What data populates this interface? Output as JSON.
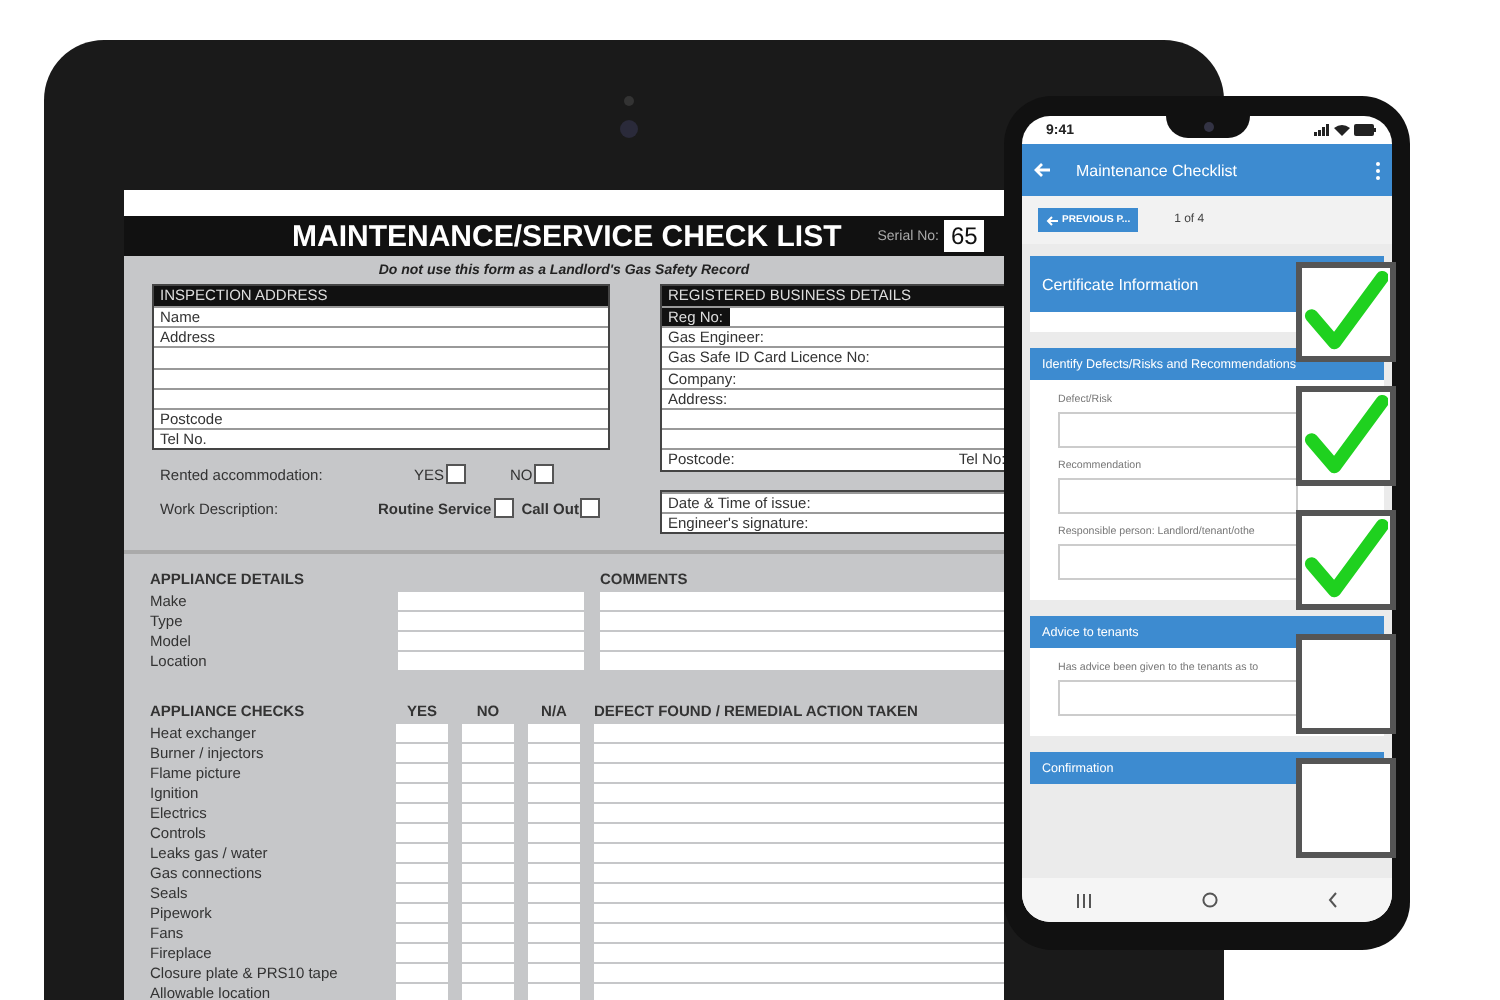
{
  "tablet_form": {
    "title": "MAINTENANCE/SERVICE CHECK LIST",
    "serial_label": "Serial No:",
    "serial_value": "65",
    "notice": "Do not use this form as a Landlord's Gas Safety Record",
    "inspection_address": {
      "heading": "INSPECTION ADDRESS",
      "rows": [
        {
          "kind": "field",
          "label": "Name"
        },
        {
          "kind": "field",
          "label": "Address"
        },
        {
          "kind": "blank"
        },
        {
          "kind": "blank"
        },
        {
          "kind": "blank"
        },
        {
          "kind": "field",
          "label": "Postcode"
        },
        {
          "kind": "field",
          "label": "Tel No."
        }
      ]
    },
    "rented": {
      "label": "Rented accommodation:",
      "options": [
        {
          "label": "YES",
          "checked": false
        },
        {
          "label": "NO",
          "checked": false
        }
      ]
    },
    "work": {
      "label": "Work Description:",
      "options": [
        {
          "label": "Routine Service",
          "checked": false
        },
        {
          "label": "Call Out",
          "checked": false
        }
      ]
    },
    "business_details": {
      "heading": "REGISTERED BUSINESS DETAILS",
      "rows": [
        {
          "kind": "inline",
          "label": "Reg No:"
        },
        {
          "kind": "field",
          "label": "Gas Engineer:"
        },
        {
          "kind": "field",
          "label": "Gas Safe ID Card Licence No:"
        },
        {
          "kind": "field",
          "label": "Company:"
        },
        {
          "kind": "field",
          "label": "Address:"
        },
        {
          "kind": "blank"
        },
        {
          "kind": "blank"
        },
        {
          "kind": "pair",
          "label": "Postcode:",
          "label2": "Tel No:"
        }
      ]
    },
    "issue_rows": [
      "Date & Time of issue:",
      "Engineer's signature:"
    ],
    "appliance_details": {
      "heading": "APPLIANCE DETAILS",
      "comments_heading": "COMMENTS",
      "rows": [
        "Make",
        "Type",
        "Model",
        "Location"
      ]
    },
    "appliance_checks": {
      "heading": "APPLIANCE CHECKS",
      "columns": [
        "YES",
        "NO",
        "N/A"
      ],
      "action_heading": "DEFECT FOUND / REMEDIAL ACTION TAKEN",
      "rows": [
        "Heat exchanger",
        "Burner / injectors",
        "Flame picture",
        "Ignition",
        "Electrics",
        "Controls",
        "Leaks gas / water",
        "Gas connections",
        "Seals",
        "Pipework",
        "Fans",
        "Fireplace",
        "Closure plate & PRS10 tape",
        "Allowable location"
      ]
    }
  },
  "phone": {
    "time": "9:41",
    "title": "Maintenance Checklist",
    "previous_button": "PREVIOUS P...",
    "page": "1 of 4",
    "sections": [
      {
        "title": "Certificate Information"
      },
      {
        "title": "Identify Defects/Risks and Recommendations",
        "fields": [
          {
            "label": "Defect/Risk"
          },
          {
            "label": "Recommendation"
          },
          {
            "label": "Responsible person: Landlord/tenant/othe"
          }
        ]
      },
      {
        "title": "Advice to tenants",
        "fields": [
          {
            "label": "Has advice been given to the tenants as to"
          }
        ]
      },
      {
        "title": "Confirmation"
      }
    ]
  },
  "big_checkboxes": [
    {
      "checked": true
    },
    {
      "checked": true
    },
    {
      "checked": true
    },
    {
      "checked": false
    },
    {
      "checked": false
    }
  ]
}
